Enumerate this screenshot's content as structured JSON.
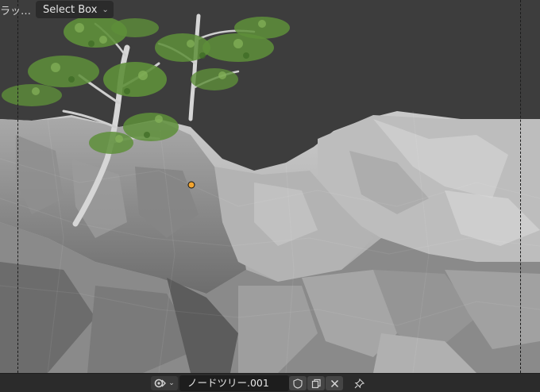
{
  "header": {
    "menu_label": "ラッ…",
    "select_mode": "Select Box"
  },
  "footer": {
    "node_tree_name": "ノードツリー.001",
    "icons": [
      "node-type-icon",
      "chevron-down-icon",
      "fake-user-shield-icon",
      "duplicate-icon",
      "close-icon",
      "pin-icon"
    ]
  },
  "colors": {
    "background": "#3d3d3d",
    "footer": "#2b2b2b",
    "origin_dot": "#f2a531",
    "foliage": "#5e8f3a",
    "terrain": "#b5b5b5"
  }
}
